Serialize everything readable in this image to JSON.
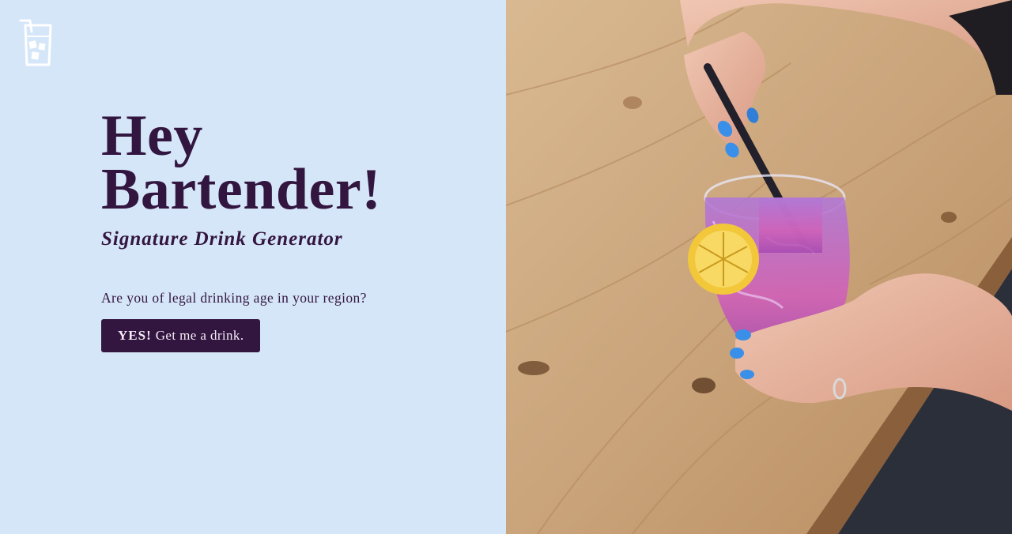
{
  "brand": {
    "logo_icon": "drink-glass-icon",
    "logo_color": "#ffffff"
  },
  "hero": {
    "title_line1": "Hey",
    "title_line2": "Bartender!",
    "subtitle": "Signature Drink Generator",
    "question": "Are you of legal drinking age in your region?",
    "button_emphasis": "YES!",
    "button_rest": "Get me a drink."
  },
  "photo": {
    "subject": "hands-holding-pink-cocktail-with-lemon-on-wooden-table"
  },
  "colors": {
    "left_background": "#d5e6f8",
    "primary_text": "#331640",
    "button_background": "#331640",
    "button_text": "#f3ecf6",
    "wood": "#c9a47c",
    "drink": "#c55bb6",
    "lemon": "#f2c83a",
    "nails": "#3a8fe8"
  }
}
